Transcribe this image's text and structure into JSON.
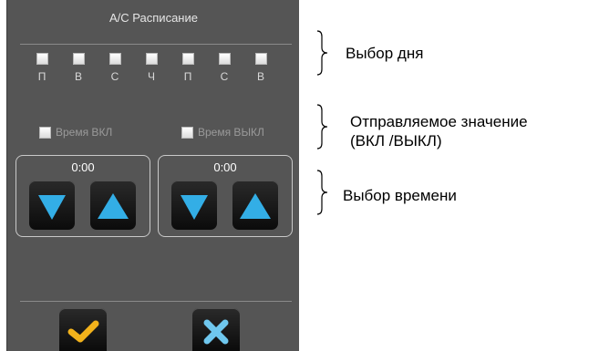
{
  "panel": {
    "title": "A/C Расписание",
    "days": [
      "П",
      "В",
      "С",
      "Ч",
      "П",
      "С",
      "В"
    ],
    "send_on_label": "Время ВКЛ",
    "send_off_label": "Время ВЫКЛ",
    "time_on": "0:00",
    "time_off": "0:00"
  },
  "annotations": {
    "day_select": "Выбор дня",
    "sent_value_line1": "Отправляемое значение",
    "sent_value_line2": "(ВКЛ /ВЫКЛ)",
    "time_select": "Выбор времени"
  },
  "colors": {
    "panel_bg": "#555555",
    "arrow_blue": "#33aee6",
    "confirm_yellow": "#f2b21b",
    "cancel_blue": "#6fc7ee"
  }
}
